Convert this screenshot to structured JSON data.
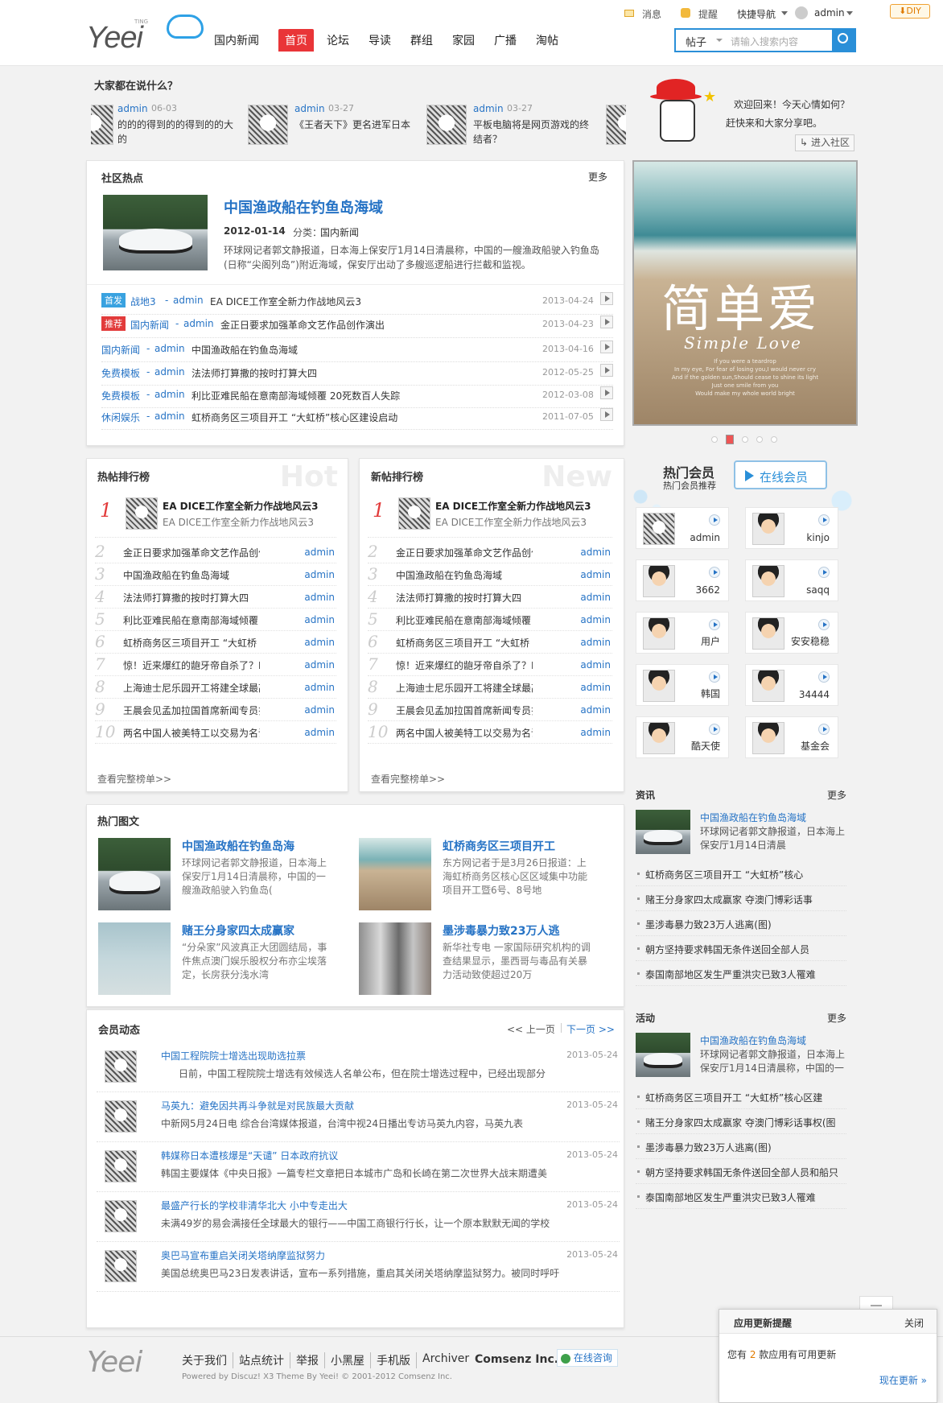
{
  "topbar": {
    "msg": "消息",
    "remind": "提醒",
    "quicknav": "快捷导航",
    "user": "admin",
    "diy": "DIY"
  },
  "logo": {
    "text": "Yeei",
    "sub": "TING"
  },
  "nav": [
    "国内新闻",
    "首页",
    "论坛",
    "导读",
    "群组",
    "家园",
    "广播",
    "淘帖"
  ],
  "nav_active": 1,
  "search": {
    "type": "帖子",
    "placeholder": "请输入搜索内容"
  },
  "talk": {
    "title": "大家都在说什么？",
    "items": [
      {
        "user": "admin",
        "date": "06-03",
        "text": "的的的得到的的得到的的大的"
      },
      {
        "user": "admin",
        "date": "03-27",
        "text": "《王者天下》更名进军日本"
      },
      {
        "user": "admin",
        "date": "03-27",
        "text": "平板电脑将是网页游戏的终结者？"
      }
    ]
  },
  "welcome": {
    "line1": "欢迎回来！今天心情如何？",
    "line2": "赶快来和大家分享吧。",
    "btn": "进入社区"
  },
  "hot": {
    "title": "社区热点",
    "more": "更多",
    "feature": {
      "title": "中国渔政船在钓鱼岛海域",
      "date": "2012-01-14",
      "cat_label": "分类：",
      "cat": "国内新闻",
      "desc": "环球网记者郭文静报道，日本海上保安厅1月14日清晨称，中国的一艘渔政船驶入钓鱼岛(日称“尖阁列岛”)附近海域，保安厅出动了多艘巡逻船进行拦截和监视。"
    },
    "items": [
      {
        "tag": "首发",
        "tagcolor": "#39a2e0",
        "cat": "战地3",
        "user": "admin",
        "title": "EA DICE工作室全新力作战地风云3",
        "date": "2013-04-24"
      },
      {
        "tag": "推荐",
        "tagcolor": "#e23b3b",
        "cat": "国内新闻",
        "user": "admin",
        "title": "金正日要求加强革命文艺作品创作演出",
        "date": "2013-04-23"
      },
      {
        "tag": "",
        "tagcolor": "",
        "cat": "国内新闻",
        "user": "admin",
        "title": "中国渔政船在钓鱼岛海域",
        "date": "2013-04-16"
      },
      {
        "tag": "",
        "tagcolor": "",
        "cat": "免费模板",
        "user": "admin",
        "title": "法法师打算撒的按时打算大四",
        "date": "2012-05-25"
      },
      {
        "tag": "",
        "tagcolor": "",
        "cat": "免费模板",
        "user": "admin",
        "title": "利比亚难民船在意南部海域倾覆 20死数百人失踪",
        "date": "2012-03-08"
      },
      {
        "tag": "",
        "tagcolor": "",
        "cat": "休闲娱乐",
        "user": "admin",
        "title": "虹桥商务区三项目开工 “大虹桥”核心区建设启动",
        "date": "2011-07-05"
      }
    ]
  },
  "slide": {
    "cn": "简单爱",
    "en": "Simple Love",
    "poem": [
      "If you were a teardrop",
      "In my eye, For fear of losing you,I would never cry",
      "And if the golden sun,Should cease to shine its light",
      "Just one smile from you",
      "Would make my whole world bright"
    ]
  },
  "hotrank": {
    "title": "热帖排行榜",
    "bg": "Hot",
    "more": "查看完整榜单>>"
  },
  "newrank": {
    "title": "新帖排行榜",
    "bg": "New",
    "more": "查看完整榜单>>"
  },
  "rank_top": {
    "num": "1",
    "title": "EA DICE工作室全新力作战地风云3",
    "sub": "EA DICE工作室全新力作战地风云3"
  },
  "rank_items": [
    {
      "num": "2",
      "title": "金正日要求加强革命文艺作品创作",
      "user": "admin"
    },
    {
      "num": "3",
      "title": "中国渔政船在钓鱼岛海域",
      "user": "admin"
    },
    {
      "num": "4",
      "title": "法法师打算撒的按时打算大四",
      "user": "admin"
    },
    {
      "num": "5",
      "title": "利比亚难民船在意南部海域倾覆 2",
      "user": "admin"
    },
    {
      "num": "6",
      "title": "虹桥商务区三项目开工 “大虹桥",
      "user": "admin"
    },
    {
      "num": "7",
      "title": "惊！近来爆红的龅牙帝自杀了？PS",
      "user": "admin"
    },
    {
      "num": "8",
      "title": "上海迪士尼乐园开工将建全球最高",
      "user": "admin"
    },
    {
      "num": "9",
      "title": "王晨会见孟加拉国首席新闻专员扎",
      "user": "admin"
    },
    {
      "num": "10",
      "title": "两名中国人被美特工以交易为名诱",
      "user": "admin"
    }
  ],
  "members": {
    "title": "热门会员",
    "sub": "热门会员推荐",
    "online": "在线会员",
    "list": [
      "admin",
      "kinjo",
      "3662",
      "saqq",
      "用户",
      "安安稳稳",
      "韩国",
      "34444",
      "酷天使",
      "基金会"
    ]
  },
  "pics": {
    "title": "热门图文",
    "items": [
      {
        "title": "中国渔政船在钓鱼岛海",
        "desc": "环球网记者郭文静报道，日本海上保安厅1月14日清晨称，中国的一艘渔政船驶入钓鱼岛("
      },
      {
        "title": "虹桥商务区三项目开工",
        "desc": "东方网记者于是3月26日报道：上海虹桥商务区核心区区域集中功能项目开工暨6号、8号地"
      },
      {
        "title": "赌王分身家四太成赢家",
        "desc": "“分朵家”风波真正大团圆结局，事件焦点澳门娱乐股权分布亦尘埃落定，长房获分浅水湾"
      },
      {
        "title": "墨涉毒暴力致23万人逃",
        "desc": "新华社专电 一家国际研究机构的调查结果显示，墨西哥与毒品有关暴力活动致使超过20万"
      }
    ]
  },
  "news": {
    "title": "资讯",
    "more": "更多",
    "feature": {
      "title": "中国渔政船在钓鱼岛海域",
      "desc": "环球网记者郭文静报道，日本海上保安厅1月14日清晨"
    },
    "items": [
      "虹桥商务区三项目开工 “大虹桥”核心",
      "赌王分身家四太成赢家 夺澳门博彩话事",
      "墨涉毒暴力致23万人逃离(图)",
      "朝方坚持要求韩国无条件送回全部人员",
      "泰国南部地区发生严重洪灾已致3人罹难"
    ]
  },
  "activity": {
    "title": "活动",
    "more": "更多",
    "feature": {
      "title": "中国渔政船在钓鱼岛海域",
      "desc": "环球网记者郭文静报道，日本海上保安厅1月14日清晨称，中国的一"
    },
    "items": [
      "虹桥商务区三项目开工 “大虹桥”核心区建",
      "赌王分身家四太成赢家 夺澳门博彩话事权(图",
      "墨涉毒暴力致23万人逃离(图)",
      "朝方坚持要求韩国无条件送回全部人员和船只",
      "泰国南部地区发生严重洪灾已致3人罹难"
    ]
  },
  "dynamic": {
    "title": "会员动态",
    "prev": "<< 上一页",
    "next": "下一页 >>",
    "items": [
      {
        "title": "中国工程院院士增选出现助选拉票",
        "date": "2013-05-24",
        "desc": "日前，中国工程院院士增选有效候选人名单公布，但在院士增选过程中，已经出现部分"
      },
      {
        "title": "马英九：避免因共再斗争就是对民族最大贡献",
        "date": "2013-05-24",
        "desc": "中新网5月24日电 综合台湾媒体报道，台湾中视24日播出专访马英九内容，马英九表"
      },
      {
        "title": "韩媒称日本遭核爆是“天谴” 日本政府抗议",
        "date": "2013-05-24",
        "desc": "韩国主要媒体《中央日报》一篇专栏文章把日本城市广岛和长崎在第二次世界大战末期遭美"
      },
      {
        "title": "最盛产行长的学校非清华北大 小中专走出大",
        "date": "2013-05-24",
        "desc": "未满49岁的易会满接任全球最大的银行——中国工商银行行长，让一个原本默默无闻的学校"
      },
      {
        "title": "奥巴马宣布重启关闭关塔纳摩监狱努力",
        "date": "2013-05-24",
        "desc": "美国总统奥巴马23日发表讲话，宣布一系列措施，重启其关闭关塔纳摩监狱努力。被同时呼吁"
      }
    ]
  },
  "footer": {
    "links": [
      "关于我们",
      "站点统计",
      "举报",
      "小黑屋",
      "手机版",
      "Archiver"
    ],
    "company": "Comsenz Inc.",
    "consult": "在线咨询",
    "powered": "Powered by Discuz! X3 Theme By Yeei! © 2001-2012 Comsenz Inc."
  },
  "notify": {
    "title": "应用更新提醒",
    "close": "关闭",
    "pre": "您有 ",
    "count": "2",
    "post": " 款应用有可用更新",
    "link": "现在更新 »"
  }
}
